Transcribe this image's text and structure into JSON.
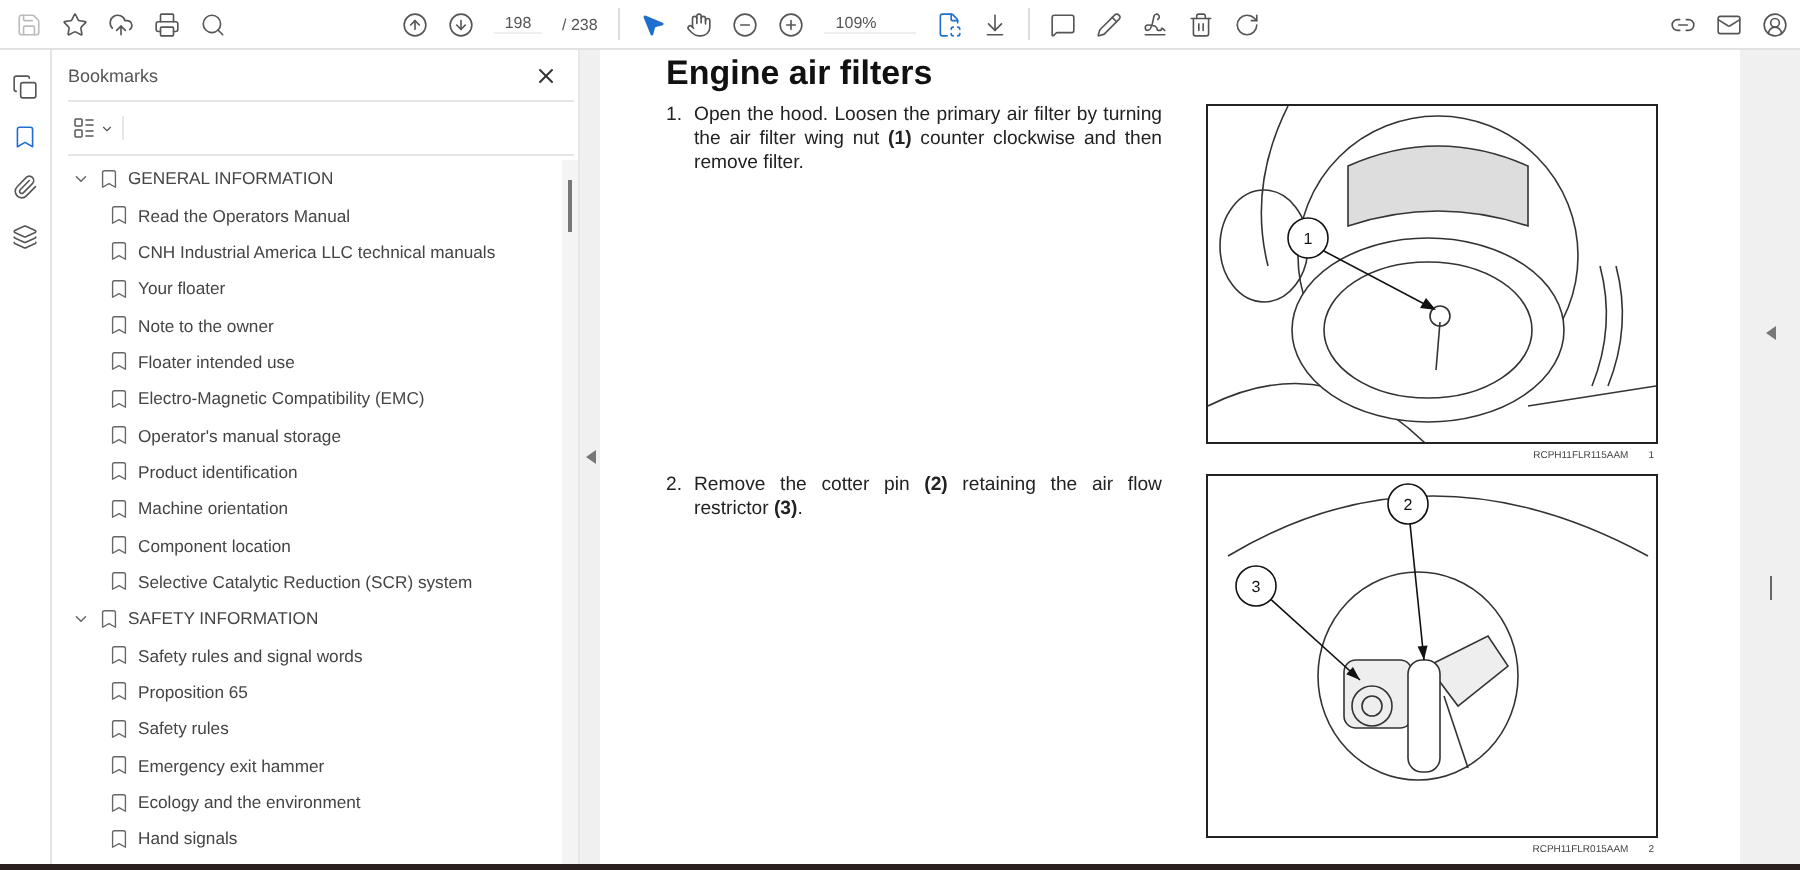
{
  "toolbar": {
    "left_tools": [
      {
        "kind": "save",
        "disabled": true
      },
      {
        "kind": "star",
        "disabled": false
      },
      {
        "kind": "upload",
        "disabled": false
      },
      {
        "kind": "print",
        "disabled": false
      },
      {
        "kind": "find",
        "disabled": false
      }
    ],
    "page_field": "198",
    "page_total": "/ 238",
    "tools": [
      {
        "kind": "select",
        "selected": true
      },
      {
        "kind": "hand",
        "selected": false
      },
      {
        "kind": "zoom_out",
        "selected": false
      },
      {
        "kind": "zoom_in",
        "selected": false
      }
    ],
    "zoom_field": "109%",
    "right_tools": [
      {
        "kind": "comment"
      },
      {
        "kind": "pen"
      },
      {
        "kind": "sign"
      },
      {
        "kind": "trash"
      },
      {
        "kind": "rotate"
      }
    ],
    "account_tools": [
      {
        "kind": "share"
      },
      {
        "kind": "mail"
      },
      {
        "kind": "account"
      }
    ]
  },
  "rail": [
    {
      "kind": "pages",
      "selected": false
    },
    {
      "kind": "bookmarks",
      "selected": true
    },
    {
      "kind": "attachments",
      "selected": false
    },
    {
      "kind": "layers",
      "selected": false
    }
  ],
  "bookmarks": {
    "title": "Bookmarks",
    "items": [
      {
        "label": "GENERAL INFORMATION",
        "expanded": true,
        "children": [
          {
            "label": "Read the Operators Manual"
          },
          {
            "label": "CNH Industrial America LLC technical manuals"
          },
          {
            "label": "Your floater"
          },
          {
            "label": "Note to the owner"
          },
          {
            "label": "Floater intended use"
          },
          {
            "label": "Electro-Magnetic Compatibility (EMC)"
          },
          {
            "label": "Operator's manual storage"
          },
          {
            "label": "Product identification"
          },
          {
            "label": "Machine orientation"
          },
          {
            "label": "Component location"
          },
          {
            "label": "Selective Catalytic Reduction (SCR) system"
          }
        ]
      },
      {
        "label": "SAFETY INFORMATION",
        "expanded": true,
        "children": [
          {
            "label": "Safety rules and signal words"
          },
          {
            "label": "Proposition 65"
          },
          {
            "label": "Safety rules"
          },
          {
            "label": "Emergency exit hammer"
          },
          {
            "label": "Ecology and the environment"
          },
          {
            "label": "Hand signals"
          }
        ]
      }
    ]
  },
  "page": {
    "title": "Engine air filters",
    "steps": [
      {
        "number": "1.",
        "text": "Open the hood. Loosen the primary air filter by turning the air filter wing nut **(1)** counter clockwise and then remove filter.",
        "figure": {
          "kind": "filter_housing",
          "callouts": [
            "1"
          ],
          "code": "RCPH11FLR115AAM",
          "number": "1"
        }
      },
      {
        "number": "2.",
        "text": "Remove the cotter pin **(2)** retaining the air flow restrictor **(3)**.",
        "figure": {
          "kind": "restrictor",
          "callouts": [
            "2",
            "3"
          ],
          "code": "RCPH11FLR015AAM",
          "number": "2"
        }
      }
    ]
  }
}
